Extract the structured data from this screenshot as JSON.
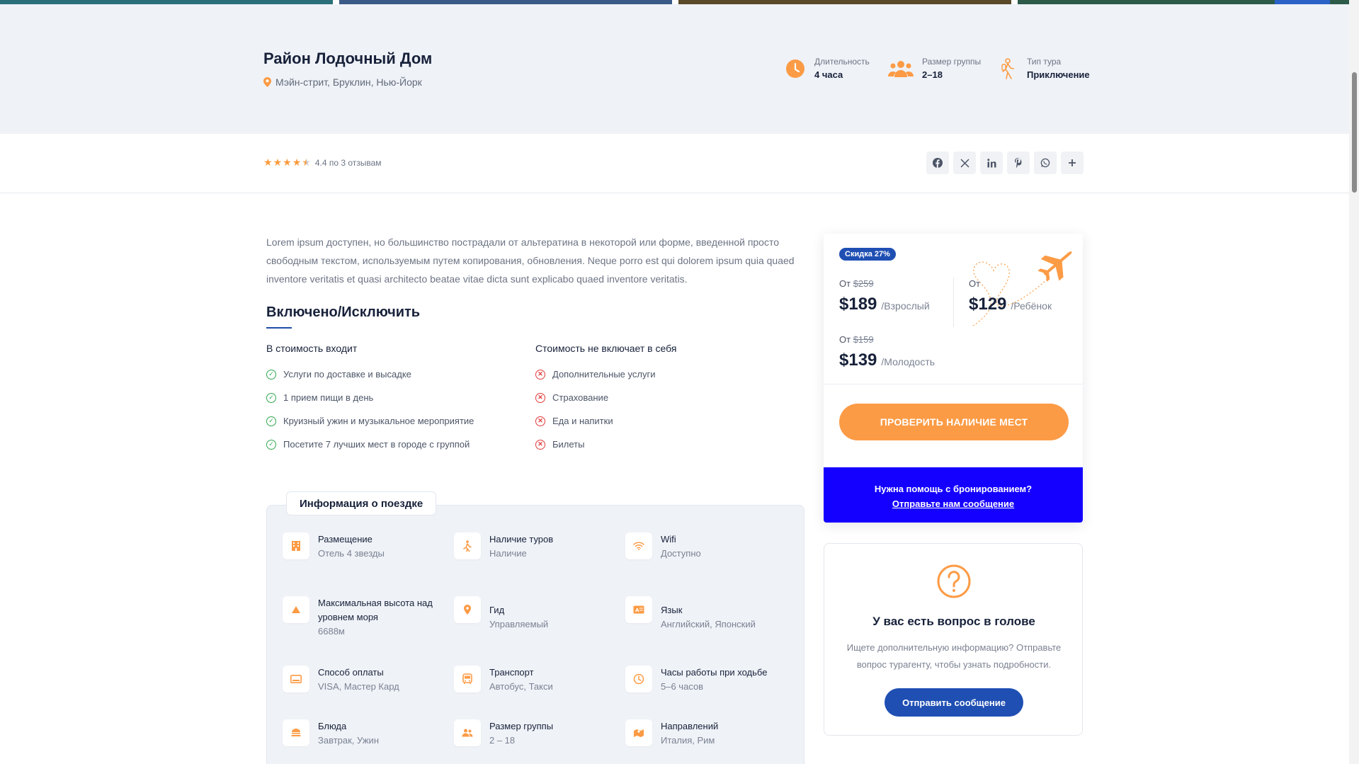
{
  "tour": {
    "title": "Район Лодочный Дом",
    "location": "Мэйн-стрит, Бруклин, Нью-Йорк",
    "meta": [
      {
        "label": "Длительность",
        "value": "4 часа",
        "icon": "clock-icon"
      },
      {
        "label": "Размер группы",
        "value": "2–18",
        "icon": "group-icon"
      },
      {
        "label": "Тип тура",
        "value": "Приключение",
        "icon": "hiker-icon"
      }
    ]
  },
  "rating": {
    "score_text": "4.4 по 3 отзывам",
    "stars": 4.5
  },
  "share": [
    "facebook-icon",
    "x-icon",
    "linkedin-icon",
    "pinterest-icon",
    "whatsapp-icon",
    "plus-icon"
  ],
  "description": "Lorem ipsum доступен, но большинство пострадали от альтератина в некоторой или форме, введенной просто свободным текстом, используемым путем копирования, обновления. Neque porro est qui dolorem ipsum quia quaed inventore veritatis et quasi architecto beatae vitae dicta sunt explicabo quaed inventore veritatis.",
  "included": {
    "title": "Включено/Исключить",
    "included_head": "В стоимость входит",
    "included_items": [
      "Услуги по доставке и высадке",
      "1 прием пищи в день",
      "Круизный ужин и музыкальное мероприятие",
      "Посетите 7 лучших мест в городе с группой"
    ],
    "excluded_head": "Стоимость не включает в себя",
    "excluded_items": [
      "Дополнительные услуги",
      "Страхование",
      "Еда и напитки",
      "Билеты"
    ]
  },
  "info": {
    "tab": "Информация о поездке",
    "cells": [
      {
        "title": "Размещение",
        "sub": "Отель 4 звезды",
        "icon": "hotel-icon"
      },
      {
        "title": "Наличие туров",
        "sub": "Наличие",
        "icon": "walker-icon"
      },
      {
        "title": "Wifi",
        "sub": "Доступно",
        "icon": "wifi-icon"
      },
      {
        "title": "Максимальная высота над уровнем моря",
        "sub": "6688м",
        "icon": "mountain-icon"
      },
      {
        "title": "Гид",
        "sub": "Управляемый",
        "icon": "guide-pin-icon"
      },
      {
        "title": "Язык",
        "sub": "Английский, Японский",
        "icon": "language-icon"
      },
      {
        "title": "Способ оплаты",
        "sub": "VISA, Мастер Кард",
        "icon": "card-icon"
      },
      {
        "title": "Транспорт",
        "sub": "Автобус, Такси",
        "icon": "bus-icon"
      },
      {
        "title": "Часы работы при ходьбе",
        "sub": "5–6 часов",
        "icon": "clock-icon"
      },
      {
        "title": "Блюда",
        "sub": "Завтрак, Ужин",
        "icon": "burger-icon"
      },
      {
        "title": "Размер группы",
        "sub": "2 – 18",
        "icon": "group-icon"
      },
      {
        "title": "Направлений",
        "sub": "Италия, Рим",
        "icon": "map-icon"
      }
    ]
  },
  "booking": {
    "discount": "Скидка 27%",
    "prices": [
      {
        "from": "От",
        "old": "$259",
        "price": "$189",
        "unit": "/Взрослый"
      },
      {
        "from": "От",
        "old": "",
        "price": "$129",
        "unit": "/Ребёнок"
      },
      {
        "from": "От",
        "old": "$159",
        "price": "$139",
        "unit": "/Молодость"
      }
    ],
    "check_button": "ПРОВЕРИТЬ НАЛИЧИЕ МЕСТ",
    "help_text": "Нужна помощь с бронированием?",
    "help_link": "Отправьте нам сообщение"
  },
  "question": {
    "title": "У вас есть вопрос в голове",
    "text": "Ищете дополнительную информацию? Отправьте вопрос турагенту, чтобы узнать подробности.",
    "button": "Отправить сообщение"
  },
  "colors": {
    "accent_orange": "#fc9b45",
    "brand_blue": "#1f4fb3",
    "help_blue": "#1400ff",
    "check_green": "#2fa84f",
    "cross_red": "#e23a3a"
  }
}
